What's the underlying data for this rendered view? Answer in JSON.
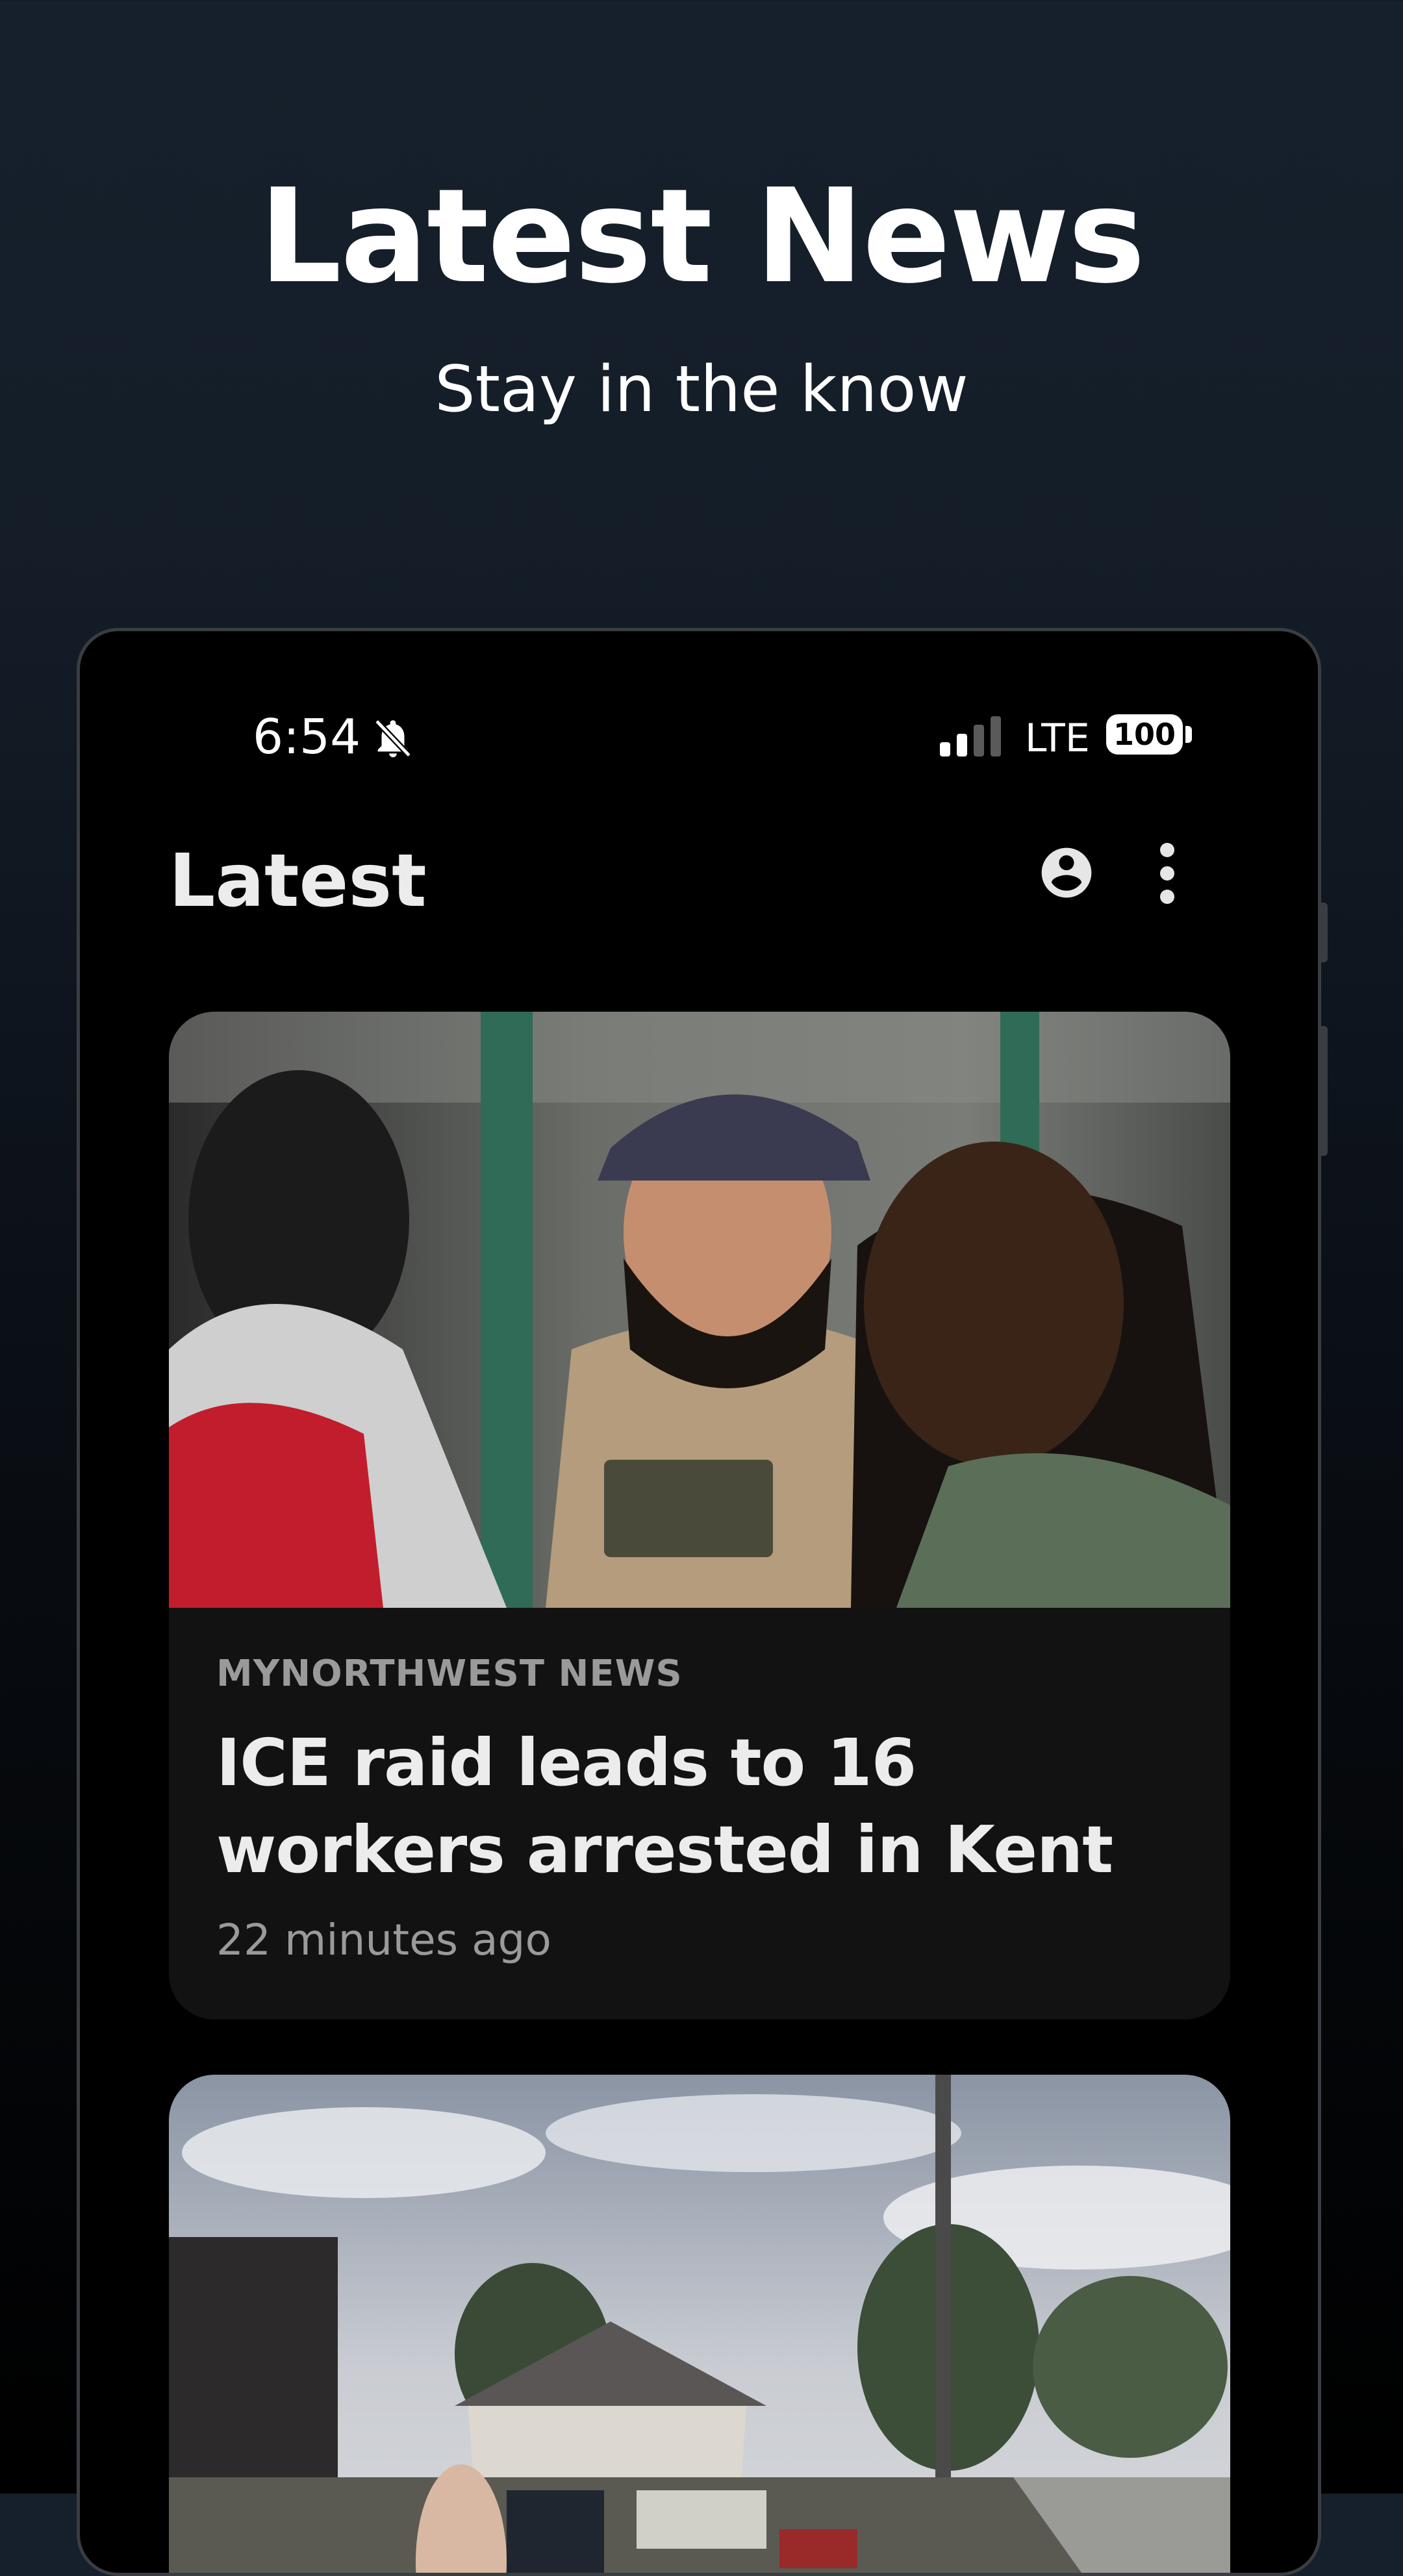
{
  "hero": {
    "title": "Latest News",
    "subtitle": "Stay in the know"
  },
  "status_bar": {
    "time": "6:54",
    "network": "LTE",
    "battery": "100",
    "icons": [
      "bell-off-icon",
      "signal-icon",
      "battery-icon"
    ]
  },
  "app_bar": {
    "title": "Latest",
    "icons": [
      "account-circle-icon",
      "more-vert-icon"
    ]
  },
  "articles": [
    {
      "source": "MYNORTHWEST NEWS",
      "headline": "ICE raid leads to 16 workers arrested in Kent",
      "time": "22 minutes ago"
    }
  ],
  "colors": {
    "background_top": "#16202c",
    "background_bottom": "#000000",
    "card": "#121212",
    "headline": "#ececec",
    "meta": "#9a9a9a"
  }
}
